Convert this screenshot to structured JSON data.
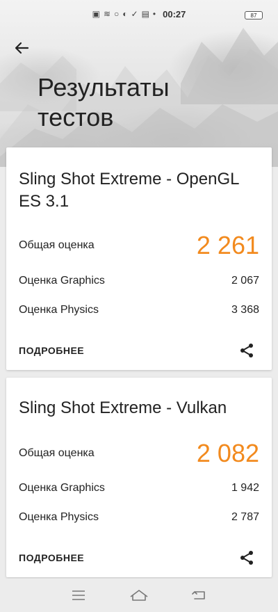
{
  "status_bar": {
    "time": "00:27",
    "battery": "87",
    "icons": [
      "file-icon",
      "wifi-icon",
      "circle-icon",
      "shield-icon",
      "check-shield-icon",
      "image-icon",
      "dot-icon"
    ]
  },
  "header": {
    "title": "Результаты тестов"
  },
  "results": [
    {
      "title": "Sling Shot Extreme - OpenGL ES 3.1",
      "overall_label": "Общая оценка",
      "overall_value": "2 261",
      "graphics_label": "Оценка Graphics",
      "graphics_value": "2 067",
      "physics_label": "Оценка Physics",
      "physics_value": "3 368",
      "more_label": "ПОДРОБНЕЕ"
    },
    {
      "title": "Sling Shot Extreme - Vulkan",
      "overall_label": "Общая оценка",
      "overall_value": "2 082",
      "graphics_label": "Оценка Graphics",
      "graphics_value": "1 942",
      "physics_label": "Оценка Physics",
      "physics_value": "2 787",
      "more_label": "ПОДРОБНЕЕ"
    }
  ],
  "colors": {
    "accent": "#f28a1e",
    "background": "#ececec",
    "card": "#ffffff"
  },
  "nav": {
    "icons": [
      "menu-icon",
      "home-icon",
      "back-nav-icon"
    ]
  }
}
